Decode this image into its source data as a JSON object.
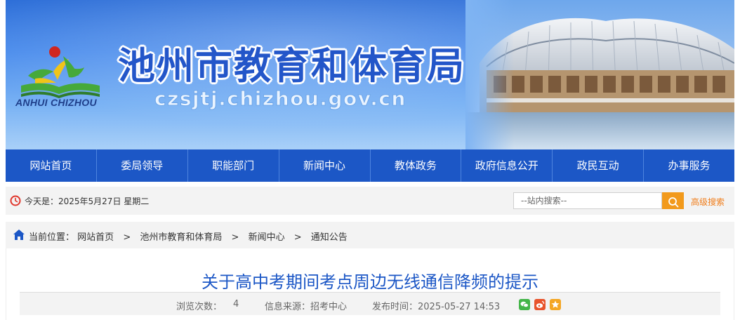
{
  "header": {
    "logo_text": "ANHUI CHIZHOU",
    "site_title": "池州市教育和体育局",
    "domain": "czsjtj.chizhou.gov.cn"
  },
  "nav": {
    "items": [
      "网站首页",
      "委局领导",
      "职能部门",
      "新闻中心",
      "教体政务",
      "政府信息公开",
      "政民互动",
      "办事服务"
    ]
  },
  "infobar": {
    "today": "今天是：2025年5月27日 星期二",
    "search_placeholder": "--站内搜索--",
    "advanced_search": "高级搜索"
  },
  "breadcrumb": {
    "label": "当前位置：",
    "items": [
      "网站首页",
      "池州市教育和体育局",
      "新闻中心",
      "通知公告"
    ],
    "separator": ">"
  },
  "article": {
    "title": "关于高中考期间考点周边无线通信降频的提示",
    "views_label": "浏览次数：",
    "views": "4",
    "source": "信息来源：招考中心",
    "published": "发布时间：2025-05-27 14:53"
  },
  "colors": {
    "nav_bg": "#1c57c6",
    "title_blue": "#1c57c6",
    "search_orange": "#f29a1c",
    "adv_link": "#f07d1a",
    "wechat_green": "#44b549",
    "weibo_orange": "#e8542c",
    "favorite_orange": "#f4a623"
  },
  "icons": {
    "clock": "clock-icon",
    "search": "search-icon",
    "home": "home-icon",
    "share": [
      "wechat-icon",
      "weibo-icon",
      "favorite-icon"
    ]
  }
}
